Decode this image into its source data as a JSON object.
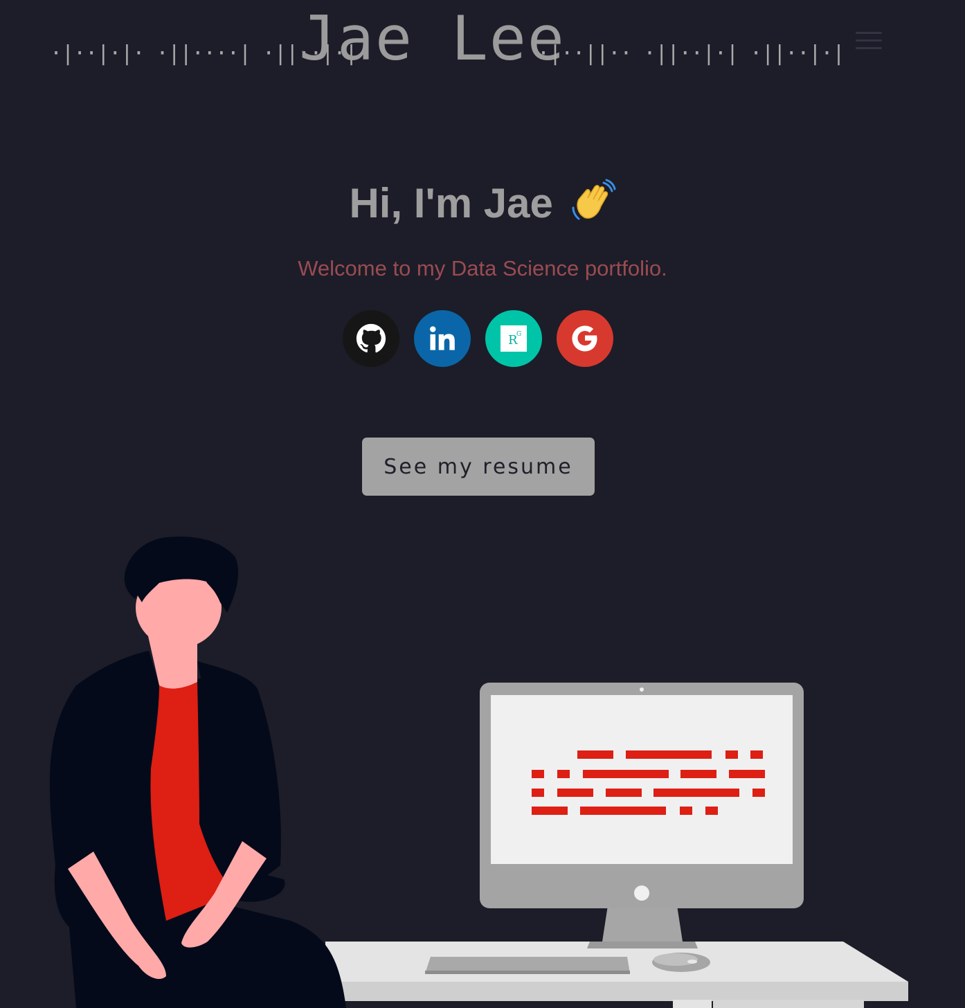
{
  "header": {
    "morse_left": "·|··|·|· ·||····| ·||··|·|",
    "name": "Jae  Lee",
    "morse_right": "·|··||·· ·||··|·| ·||··|·|",
    "menu_icon": "hamburger-icon"
  },
  "hero": {
    "greeting": "Hi, I'm Jae",
    "greeting_emoji": "waving-hand-icon",
    "subtitle": "Welcome to my Data Science portfolio."
  },
  "socials": [
    {
      "name": "github",
      "icon": "github-icon",
      "color": "#161616"
    },
    {
      "name": "linkedin",
      "icon": "linkedin-icon",
      "color": "#0a66a8"
    },
    {
      "name": "researchgate",
      "icon": "researchgate-icon",
      "color": "#00c4a8",
      "glyph": "R",
      "sup": "G"
    },
    {
      "name": "google",
      "icon": "google-icon",
      "color": "#d8392f",
      "glyph": "G"
    }
  ],
  "cta": {
    "resume_label": "See my resume"
  },
  "illustration": {
    "subject": "person-at-desk-illustration",
    "accent_color": "#dd1f14",
    "skin_color": "#ffa9a9",
    "dark_color": "#050a1a"
  }
}
